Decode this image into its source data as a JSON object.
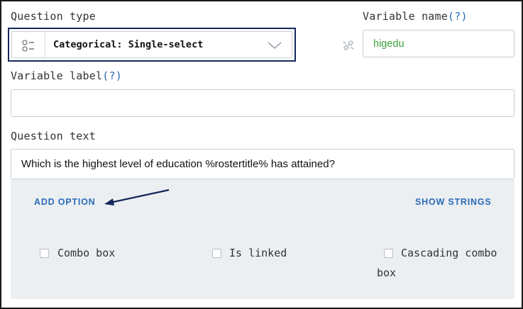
{
  "question_type": {
    "label": "Question type",
    "value": "Categorical: Single-select",
    "icon": "categorical-list-icon"
  },
  "variable_name": {
    "label": "Variable name",
    "help": "(?)",
    "value": "higedu",
    "value_color": "#3ea33e"
  },
  "variable_label": {
    "label": "Variable label",
    "help": "(?)",
    "value": ""
  },
  "question_text": {
    "label": "Question text",
    "value": "Which is the highest level of education %rostertitle% has attained?"
  },
  "options_panel": {
    "add_option": "ADD OPTION",
    "show_strings": "SHOW STRINGS",
    "checkboxes": [
      {
        "label": "Combo box",
        "checked": false
      },
      {
        "label": "Is linked",
        "checked": false
      },
      {
        "label_line1": "Cascading combo",
        "label_line2": "box",
        "checked": false
      }
    ]
  },
  "colors": {
    "accent_blue": "#2a6cb8",
    "highlight_border": "#14285a",
    "panel_background": "#eceff2"
  }
}
